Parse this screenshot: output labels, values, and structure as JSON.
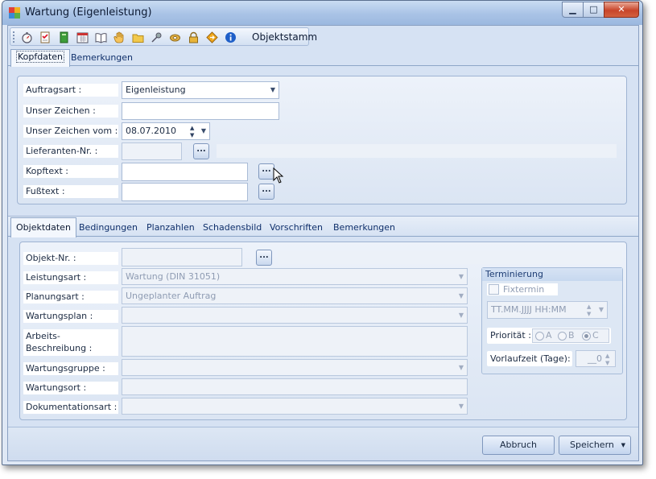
{
  "window": {
    "title": "Wartung (Eigenleistung)",
    "min_label": "▁",
    "max_label": "□",
    "close_label": "✕"
  },
  "toolbar": {
    "icons": [
      "stopwatch-icon",
      "checklist-icon",
      "book-green-icon",
      "calendar-icon",
      "open-book-icon",
      "hand-icon",
      "folder-icon",
      "pin-icon",
      "tape-icon",
      "lock-icon",
      "arrows-icon",
      "info-icon"
    ],
    "objektstamm_label": "Objektstamm"
  },
  "top_tabs": [
    "Kopfdaten",
    "Bemerkungen"
  ],
  "kopf": {
    "auftragsart_label": "Auftragsart :",
    "auftragsart_value": "Eigenleistung",
    "unser_zeichen_label": "Unser Zeichen :",
    "unser_zeichen_value": "",
    "unser_zeichen_vom_label": "Unser Zeichen vom :",
    "unser_zeichen_vom_value": "08.07.2010",
    "lieferanten_label": "Lieferanten-Nr. :",
    "lieferanten_value": "",
    "kopftext_label": "Kopftext :",
    "kopftext_value": "",
    "fusstext_label": "Fußtext :",
    "fusstext_value": "",
    "dots": "..."
  },
  "sub_tabs": [
    "Objektdaten",
    "Bedingungen",
    "Planzahlen",
    "Schadensbild",
    "Vorschriften",
    "Bemerkungen"
  ],
  "objekt": {
    "objekt_nr_label": "Objekt-Nr. :",
    "objekt_nr_value": "",
    "leistungsart_label": "Leistungsart :",
    "leistungsart_value": "Wartung (DIN 31051)",
    "planungsart_label": "Planungsart :",
    "planungsart_value": "Ungeplanter Auftrag",
    "wartungsplan_label": "Wartungsplan :",
    "arbeits_label_1": "Arbeits-",
    "arbeits_label_2": "Beschreibung :",
    "wartungsgruppe_label": "Wartungsgruppe :",
    "wartungsort_label": "Wartungsort :",
    "dokumentationsart_label": "Dokumentationsart :"
  },
  "terminierung": {
    "title": "Terminierung",
    "fixtermin_label": "Fixtermin",
    "datetime_placeholder": "TT.MM.JJJJ HH:MM",
    "prioritaet_label": "Priorität :",
    "prio_a": "A",
    "prio_b": "B",
    "prio_c": "C",
    "prio_selected": "C",
    "vorlaufzeit_label": "Vorlaufzeit (Tage):",
    "vorlaufzeit_value": "__0"
  },
  "buttons": {
    "abbruch": "Abbruch",
    "speichern": "Speichern"
  },
  "colors": {
    "frame_blue": "#a9c3e6",
    "panel_bg": "#d6e2f3",
    "close_red": "#c8452a",
    "link_blue": "#0f2f6a"
  }
}
